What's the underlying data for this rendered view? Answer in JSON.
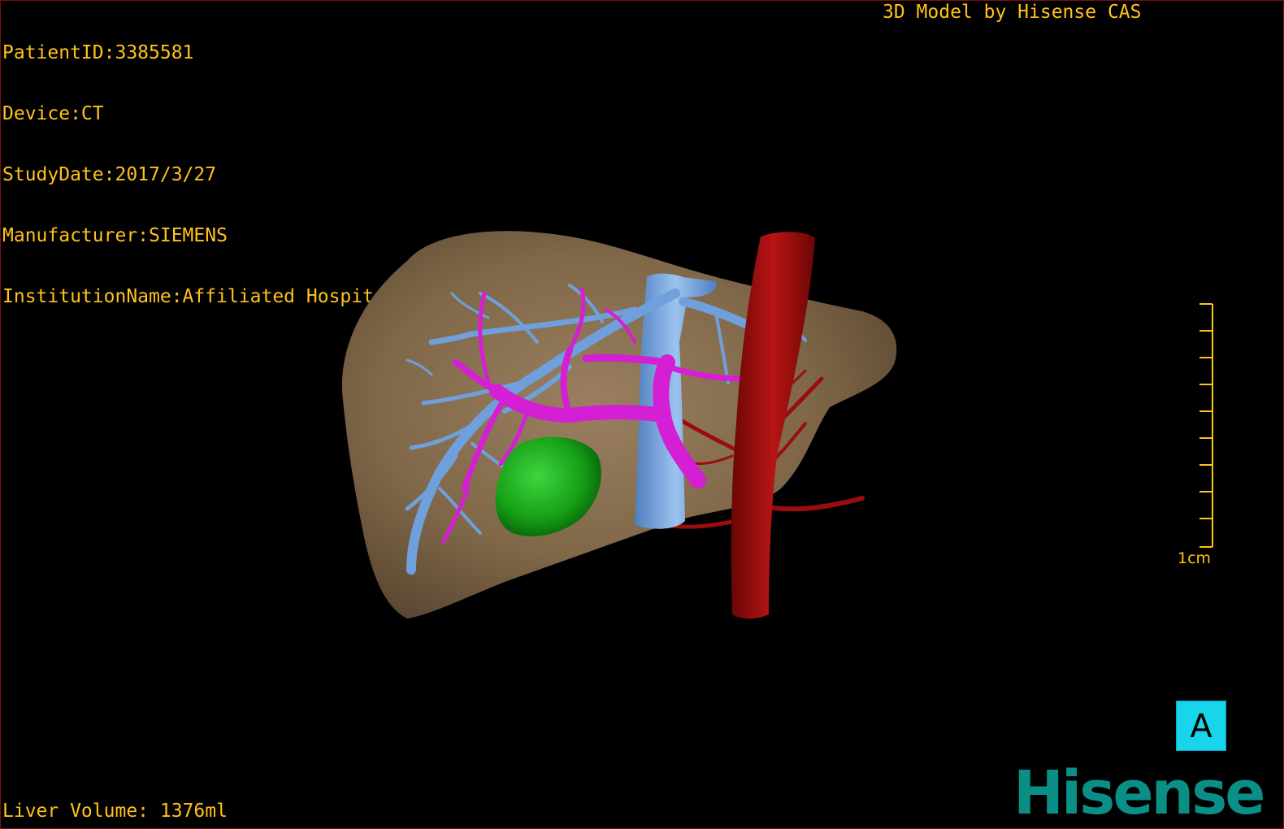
{
  "viewer": {
    "patient_id": "PatientID:3385581",
    "device": "Device:CT",
    "study_date": "StudyDate:2017/3/27",
    "manufacturer": "Manufacturer:SIEMENS",
    "institution": "InstitutionName:Affiliated Hospital Qingdao University-C",
    "credit": "3D Model by Hisense CAS",
    "liver_volume": "Liver Volume: 1376ml",
    "scale_label": "1cm",
    "orientation": "A",
    "logo": "Hisense"
  },
  "colors": {
    "overlay_text": "#ffc21a",
    "liver": "#8b7355",
    "hepatic_vein": "#6fa0dc",
    "portal_vein": "#d41fd4",
    "artery": "#9a0d0d",
    "tumor": "#1fa81f",
    "orientation_box": "#19d5eb",
    "logo": "#0a8f86"
  }
}
